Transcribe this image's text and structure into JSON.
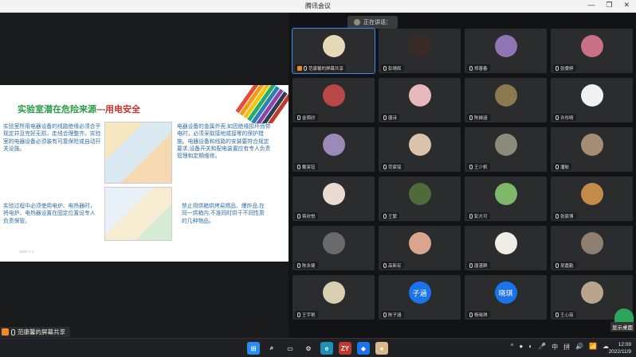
{
  "window": {
    "title": "腾讯会议",
    "minimize": "—",
    "maximize": "❐",
    "close": "✕"
  },
  "speaking": {
    "label": "正在讲话："
  },
  "slide": {
    "title_main": "实验室潜在危险来源",
    "title_sub": "—用电安全",
    "p1": "实验室所用电器设备的线路绝缘必须合乎规定并且完好无损，走线合理整齐。实验室的电器设备必须装有可靠保险或自动开关设施。",
    "p2": "电器设备的金属外壳,如因绝缘损坏而带电时，必须采取接地或接零的保护措施。电器设备和线路的安装要符合规定要求,设备开关和配电装置应有专人负责管理和定期维修。",
    "p3": "实验过程中必须使用电炉、电热器时，将电炉、电热器设置在固定位置设专人负责保管。",
    "p4": "禁止用烘箱烘烤易燃品、爆炸品,在同一烘箱内,不准同时烘干不同性质的几种物品。",
    "footer": "2022-7-4"
  },
  "presenter_tag": {
    "label": "范康馨的屏幕共享"
  },
  "participants": [
    {
      "name": "范康馨的屏幕共享",
      "avatar_color": "#e6d9b8",
      "letter": "",
      "presenter": true
    },
    {
      "name": "彭晴辉",
      "avatar_color": "#3a2a26",
      "letter": ""
    },
    {
      "name": "郑善春",
      "avatar_color": "#8f75b6",
      "letter": ""
    },
    {
      "name": "张雯婷",
      "avatar_color": "#c96f86",
      "letter": ""
    },
    {
      "name": "金周欣",
      "avatar_color": "#b84747",
      "letter": ""
    },
    {
      "name": "唐诗",
      "avatar_color": "#e7b9bd",
      "letter": ""
    },
    {
      "name": "陈嫣涵",
      "avatar_color": "#8a7a4e",
      "letter": ""
    },
    {
      "name": "许彤晴",
      "avatar_color": "#f1f1f1",
      "letter": ""
    },
    {
      "name": "戴旻钰",
      "avatar_color": "#9b89b8",
      "letter": ""
    },
    {
      "name": "范家铭",
      "avatar_color": "#d9c3ab",
      "letter": ""
    },
    {
      "name": "王少帆",
      "avatar_color": "#8c8a7a",
      "letter": ""
    },
    {
      "name": "潘航",
      "avatar_color": "#a58d74",
      "letter": ""
    },
    {
      "name": "蒋欣悦",
      "avatar_color": "#eadbd2",
      "letter": ""
    },
    {
      "name": "王繁",
      "avatar_color": "#4f6a3b",
      "letter": ""
    },
    {
      "name": "彭大可",
      "avatar_color": "#7fb86a",
      "letter": ""
    },
    {
      "name": "张宸博",
      "avatar_color": "#c48a4a",
      "letter": ""
    },
    {
      "name": "陈永健",
      "avatar_color": "#6a6a6a",
      "letter": ""
    },
    {
      "name": "高新宏",
      "avatar_color": "#d9a58d",
      "letter": ""
    },
    {
      "name": "唐湛群",
      "avatar_color": "#f0ece6",
      "letter": ""
    },
    {
      "name": "吴嘉勤",
      "avatar_color": "#8e7f70",
      "letter": ""
    },
    {
      "name": "王宇艳",
      "avatar_color": "#d7cfb0",
      "letter": ""
    },
    {
      "name": "陈子涵",
      "avatar_color": "#1a73e8",
      "letter": "子涵"
    },
    {
      "name": "杨晓琪",
      "avatar_color": "#1a73e8",
      "letter": "晓琪"
    },
    {
      "name": "王心茹",
      "avatar_color": "#b9a48e",
      "letter": ""
    }
  ],
  "show_desktop": {
    "label": "显示桌面"
  },
  "taskbar": {
    "apps": [
      {
        "name": "windows",
        "glyph": "⊞",
        "color": "#2b8cf0"
      },
      {
        "name": "search",
        "glyph": "⌕",
        "color": "transparent"
      },
      {
        "name": "taskview",
        "glyph": "▭",
        "color": "transparent"
      },
      {
        "name": "settings",
        "glyph": "⚙",
        "color": "transparent"
      },
      {
        "name": "edge",
        "glyph": "e",
        "color": "#1f8fb6"
      },
      {
        "name": "zy",
        "glyph": "ZY",
        "color": "#c0392b"
      },
      {
        "name": "meeting",
        "glyph": "◆",
        "color": "#1a73e8"
      },
      {
        "name": "avatar-app",
        "glyph": "●",
        "color": "#d9b88a"
      }
    ],
    "tray": [
      "^",
      "●",
      "◐",
      "🎤",
      "中",
      "拼",
      "🔊",
      "📶",
      "☁"
    ],
    "time": "12:09",
    "date": "2022/11/9"
  }
}
